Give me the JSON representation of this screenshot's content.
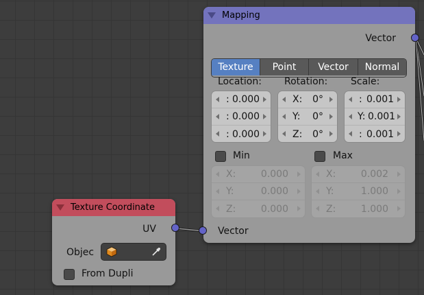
{
  "mapping_node": {
    "title": "Mapping",
    "output_label": "Vector",
    "tabs": [
      {
        "label": "Texture",
        "active": true
      },
      {
        "label": "Point",
        "active": false
      },
      {
        "label": "Vector",
        "active": false
      },
      {
        "label": "Normal",
        "active": false
      }
    ],
    "location": {
      "label": "Location:",
      "fields": [
        {
          "axis": ":",
          "value": "0.000"
        },
        {
          "axis": ":",
          "value": "0.000"
        },
        {
          "axis": ":",
          "value": "0.000"
        }
      ]
    },
    "rotation": {
      "label": "Rotation:",
      "fields": [
        {
          "axis": "X:",
          "value": "0°"
        },
        {
          "axis": "Y:",
          "value": "0°"
        },
        {
          "axis": "Z:",
          "value": "0°"
        }
      ]
    },
    "scale": {
      "label": "Scale:",
      "fields": [
        {
          "axis": ":",
          "value": "0.001"
        },
        {
          "axis": "Y:",
          "value": "0.001"
        },
        {
          "axis": ":",
          "value": "0.001"
        }
      ]
    },
    "min": {
      "label": "Min",
      "checked": false,
      "fields": [
        {
          "axis": "X:",
          "value": "0.000"
        },
        {
          "axis": "Y:",
          "value": "0.000"
        },
        {
          "axis": "Z:",
          "value": "0.000"
        }
      ]
    },
    "max": {
      "label": "Max",
      "checked": false,
      "fields": [
        {
          "axis": "X:",
          "value": "0.002"
        },
        {
          "axis": "Y:",
          "value": "1.000"
        },
        {
          "axis": "Z:",
          "value": "1.000"
        }
      ]
    },
    "input_label": "Vector"
  },
  "texcoord_node": {
    "title": "Texture Coordinate",
    "output_label": "UV",
    "object_label": "Objec",
    "from_dupli_label": "From Dupli",
    "from_dupli_checked": false
  },
  "colors": {
    "mapping_header": "#7373bd",
    "texcoord_header": "#c24d5c",
    "socket": "#6363c7",
    "active_tab": "#5680c2"
  }
}
